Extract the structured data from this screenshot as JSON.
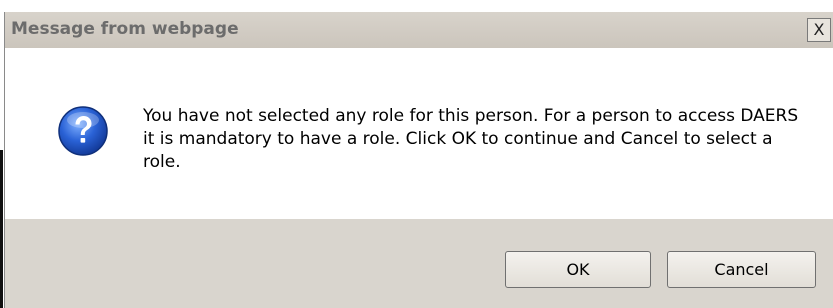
{
  "dialog": {
    "title": "Message from webpage",
    "close_glyph": "X",
    "message": "You have not selected any role for this person. For a person to access DAERS it is mandatory to have a role. Click OK to continue and Cancel to select a role.",
    "icon": "question-icon",
    "buttons": {
      "ok_label": "OK",
      "cancel_label": "Cancel"
    }
  },
  "colors": {
    "titlebar": "#cbc5bc",
    "title_text": "#6c6c6c",
    "footer": "#d9d5ce",
    "icon_blue": "#1f56c8"
  }
}
